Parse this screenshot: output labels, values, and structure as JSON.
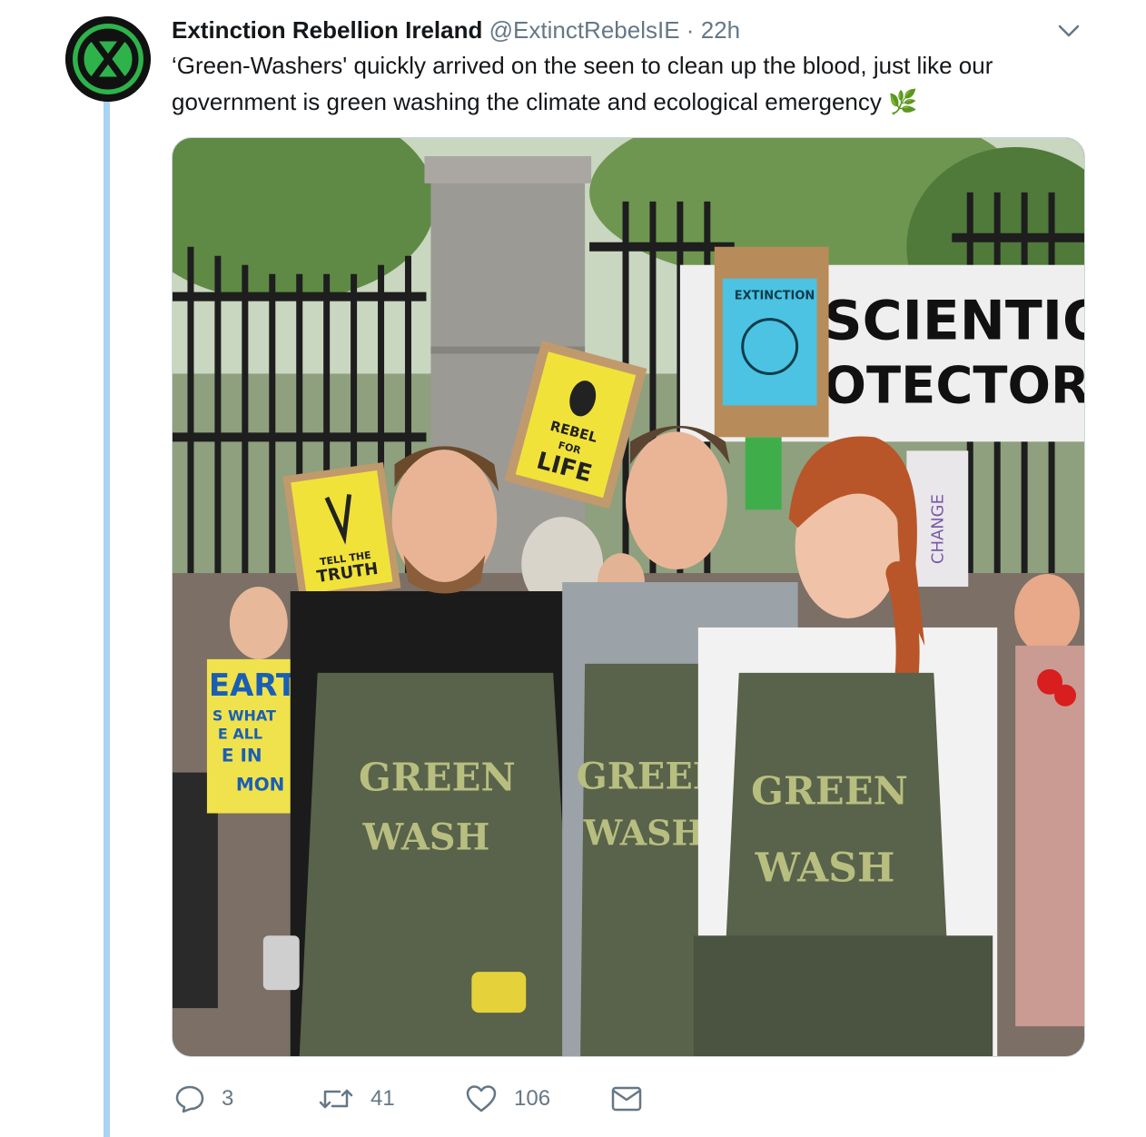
{
  "tweet": {
    "display_name": "Extinction Rebellion Ireland",
    "handle": "@ExtinctRebelsIE",
    "separator": "·",
    "time": "22h",
    "text": "‘Green-Washers' quickly arrived on the seen to clean up the blood, just like our government is green washing the climate and ecological emergency",
    "emoji": "🌿"
  },
  "media": {
    "signs": {
      "banner_line1": "SCIENTIOUS",
      "banner_line2": "OTECTORS",
      "extinction": "EXTINCTION",
      "rebel": "REBEL",
      "for": "FOR",
      "life": "LIFE",
      "tell_the": "TELL THE",
      "truth": "TRUTH",
      "earth": "EARTH",
      "earth_line2": "S WHAT",
      "earth_line3": "E ALL",
      "earth_line4": "E IN",
      "earth_line5": "MON",
      "change": "CHANGE",
      "green_1": "GREEN",
      "wash_1": "WASH",
      "green_2": "GREEN",
      "wash_2": "WASH",
      "green_3": "GREEN",
      "wash_3": "WASH"
    }
  },
  "actions": {
    "replies": "3",
    "retweets": "41",
    "likes": "106"
  },
  "icons": {
    "avatar": "extinction-symbol-icon",
    "caret": "chevron-down-icon",
    "reply": "reply-icon",
    "retweet": "retweet-icon",
    "like": "heart-icon",
    "dm": "envelope-icon"
  },
  "colors": {
    "accent_green": "#2db34a",
    "thread_line": "#a9d4f3",
    "secondary_text": "#657786"
  }
}
